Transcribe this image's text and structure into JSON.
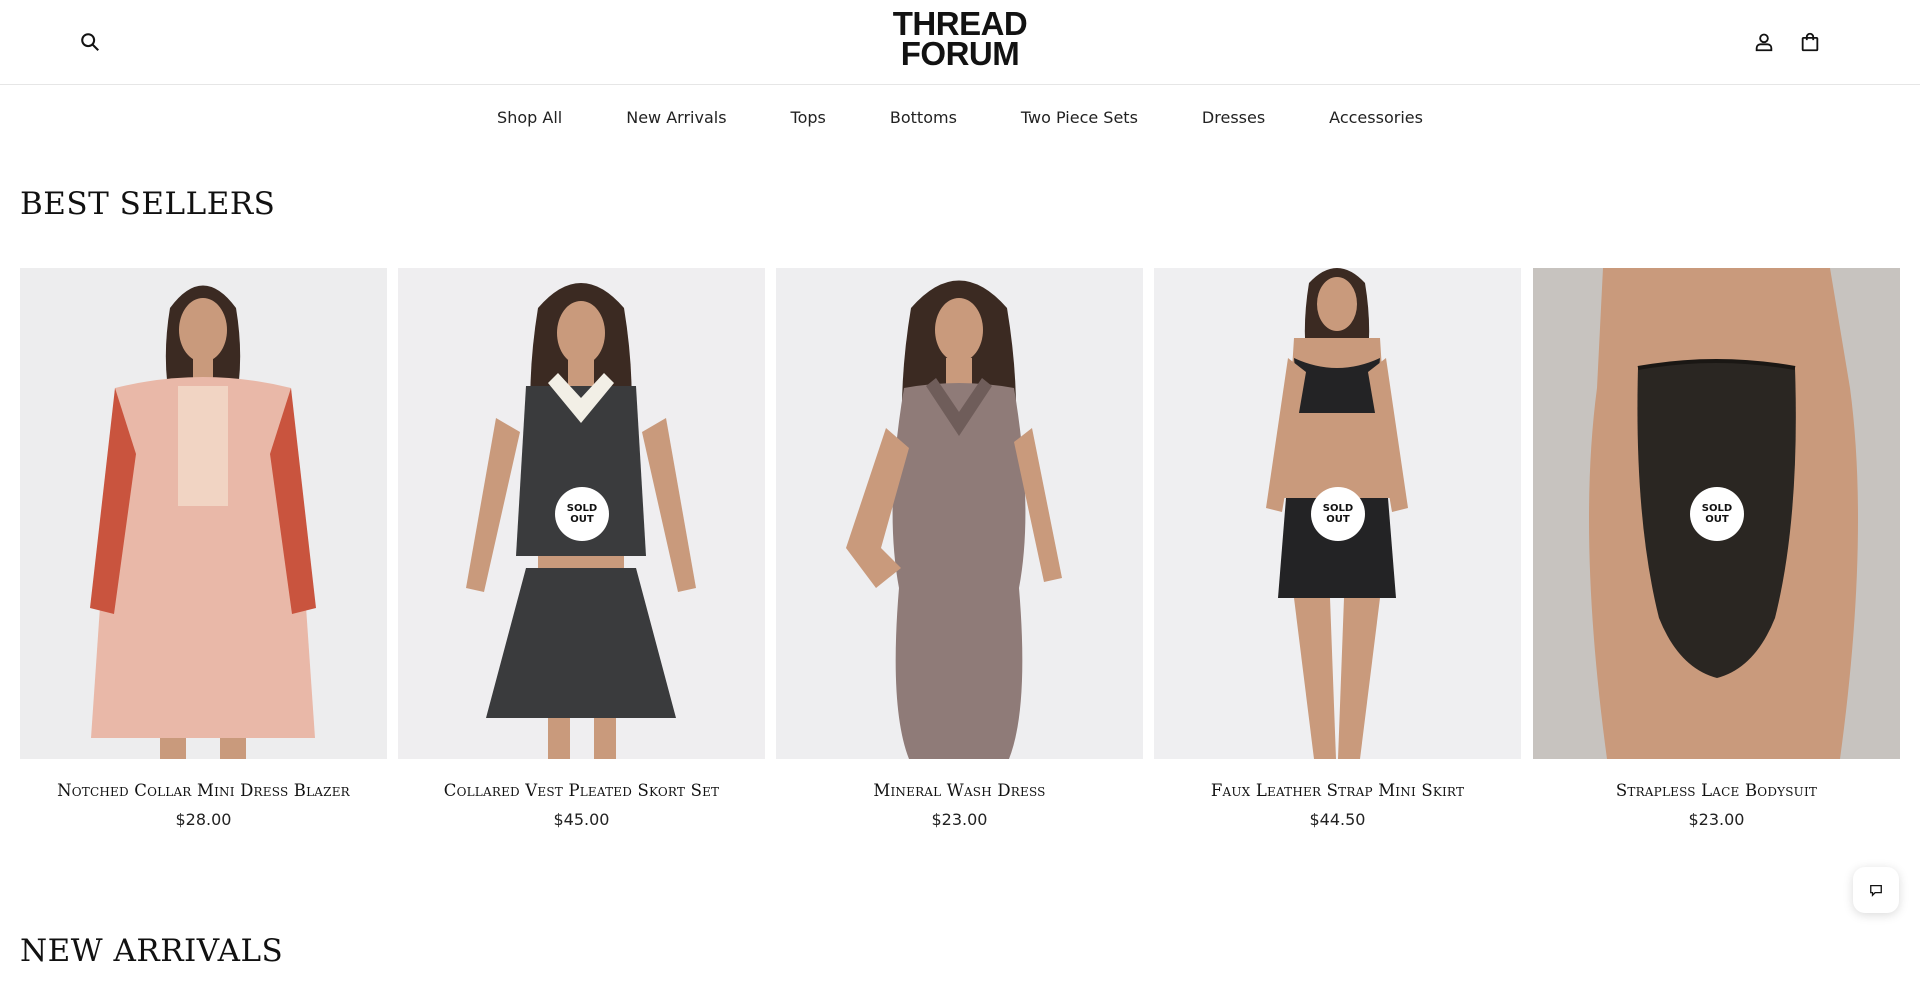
{
  "header": {
    "logo_line1": "THREAD",
    "logo_line2": "FORUM",
    "icons": [
      "search-icon",
      "account-icon",
      "shopping-bag-icon"
    ]
  },
  "nav": {
    "items": [
      "Shop All",
      "New Arrivals",
      "Tops",
      "Bottoms",
      "Two Piece Sets",
      "Dresses",
      "Accessories"
    ]
  },
  "best_sellers": {
    "title": "BEST SELLERS",
    "products": [
      {
        "name": "Notched Collar Mini Dress Blazer",
        "price": "$28.00",
        "sold_out": false,
        "colors": {
          "bg": "#ededee",
          "garment": "#e9b8a8",
          "accent": "#c9543e"
        }
      },
      {
        "name": "Collared Vest Pleated Skort Set",
        "price": "$45.00",
        "sold_out": true,
        "colors": {
          "bg": "#efeef0",
          "garment": "#3a3b3d",
          "accent": "#f2efe6"
        }
      },
      {
        "name": "Mineral Wash Dress",
        "price": "$23.00",
        "sold_out": false,
        "colors": {
          "bg": "#eeeef0",
          "garment": "#8f7b78",
          "accent": "#6f5d5a"
        }
      },
      {
        "name": "Faux Leather Strap Mini Skirt",
        "price": "$44.50",
        "sold_out": true,
        "colors": {
          "bg": "#efeff1",
          "garment": "#232325",
          "accent": "#111112"
        }
      },
      {
        "name": "Strapless Lace Bodysuit",
        "price": "$23.00",
        "sold_out": true,
        "colors": {
          "bg": "#c7c3bf",
          "garment": "#2a2622",
          "accent": "#1a1714"
        }
      }
    ],
    "badge_line1": "SOLD",
    "badge_line2": "OUT"
  },
  "new_arrivals": {
    "title": "NEW ARRIVALS"
  },
  "chat": {
    "icon": "chat-bubble-icon"
  },
  "colors": {
    "skin": "#c99a7c",
    "hair": "#3b2a22",
    "text": "#121212"
  }
}
